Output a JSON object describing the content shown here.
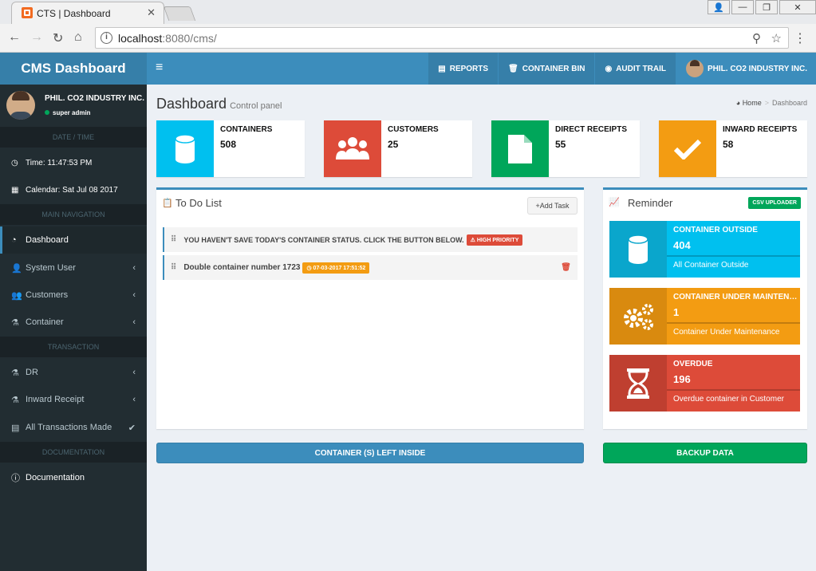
{
  "browser": {
    "tab_title": "CTS | Dashboard",
    "url_host": "localhost",
    "url_rest": ":8080/cms/"
  },
  "topbar": {
    "logo": "CMS Dashboard",
    "nav": [
      {
        "label": "REPORTS",
        "icon": "file-icon"
      },
      {
        "label": "CONTAINER BIN",
        "icon": "trash-icon"
      },
      {
        "label": "AUDIT TRAIL",
        "icon": "eye-icon"
      }
    ],
    "user": "PHIL. CO2 INDUSTRY INC."
  },
  "sidebar": {
    "user_name": "PHIL. CO2 INDUSTRY INC.",
    "user_role": "super admin",
    "header_datetime": "DATE / TIME",
    "time": "Time: 11:47:53 PM",
    "calendar": "Calendar: Sat Jul 08 2017",
    "header_main": "MAIN NAVIGATION",
    "items": [
      {
        "label": "Dashboard"
      },
      {
        "label": "System User"
      },
      {
        "label": "Customers"
      },
      {
        "label": "Container"
      }
    ],
    "header_transaction": "TRANSACTION",
    "transaction_items": [
      {
        "label": "DR"
      },
      {
        "label": "Inward Receipt"
      },
      {
        "label": "All Transactions Made"
      }
    ],
    "header_docs": "DOCUMENTATION",
    "docs_item": "Documentation"
  },
  "content": {
    "title": "Dashboard",
    "subtitle": "Control panel",
    "breadcrumb_home": "Home",
    "breadcrumb_current": "Dashboard"
  },
  "info_boxes": [
    {
      "label": "CONTAINERS",
      "value": "508",
      "color": "#00c0ef"
    },
    {
      "label": "CUSTOMERS",
      "value": "25",
      "color": "#dd4b39"
    },
    {
      "label": "DIRECT RECEIPTS",
      "value": "55",
      "color": "#00a65a"
    },
    {
      "label": "INWARD RECEIPTS",
      "value": "58",
      "color": "#f39c12"
    }
  ],
  "todo": {
    "title": "To Do List",
    "add_task": "Add Task",
    "items": [
      {
        "text": "YOU HAVEN'T SAVE TODAY'S CONTAINER STATUS. CLICK THE BUTTON BELOW.",
        "badge": "HIGH PRIORITY"
      },
      {
        "text": "Double container number 1723",
        "badge": "07-03-2017 17:51:52"
      }
    ]
  },
  "reminder": {
    "title": "Reminder",
    "badge": "CSV UPLOADER",
    "boxes": [
      {
        "label": "CONTAINER OUTSIDE",
        "value": "404",
        "desc": "All Container Outside",
        "color": "#00c0ef"
      },
      {
        "label": "CONTAINER UNDER MAINTENANCE",
        "value": "1",
        "desc": "Container Under Maintenance",
        "color": "#f39c12"
      },
      {
        "label": "OVERDUE",
        "value": "196",
        "desc": "Overdue container in Customer",
        "color": "#dd4b39"
      }
    ]
  },
  "buttons": {
    "left_inside": "CONTAINER (S) LEFT INSIDE",
    "backup": "BACKUP DATA"
  }
}
